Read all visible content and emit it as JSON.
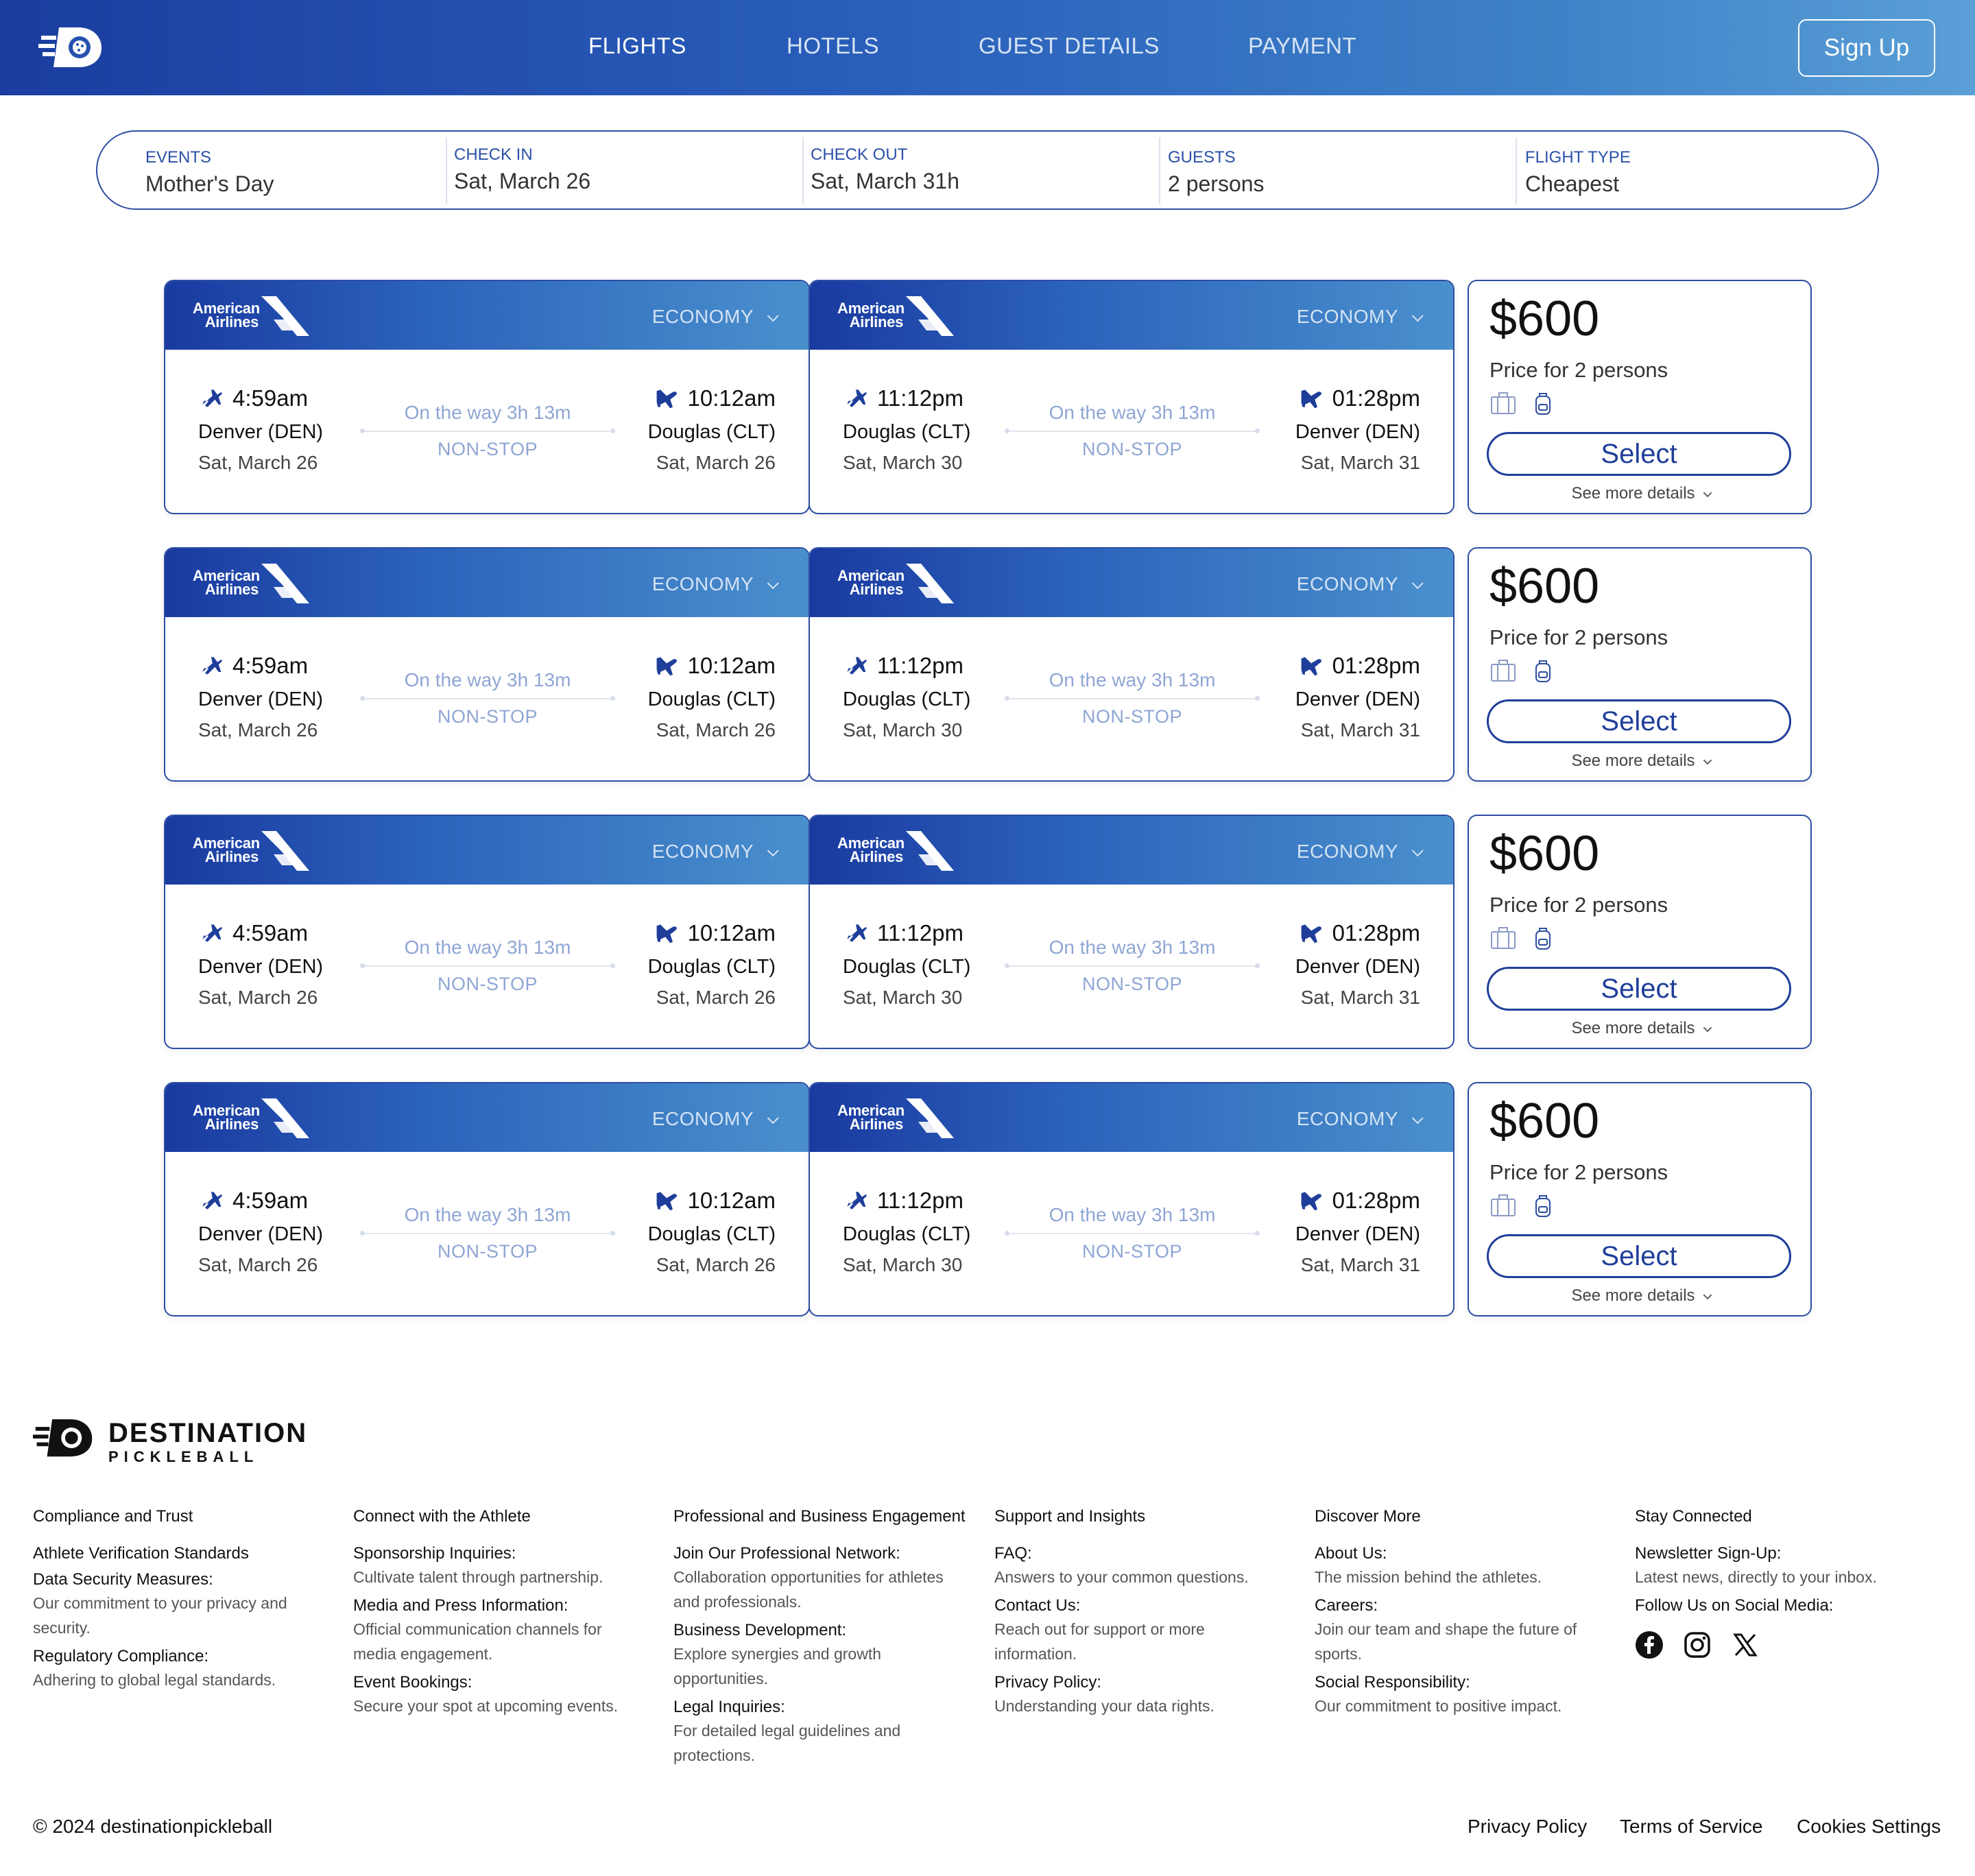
{
  "header": {
    "nav": [
      {
        "label": "FLIGHTS",
        "active": true
      },
      {
        "label": "HOTELS",
        "active": false
      },
      {
        "label": "GUEST DETAILS",
        "active": false
      },
      {
        "label": "PAYMENT",
        "active": false
      }
    ],
    "signup_label": "Sign Up"
  },
  "search": {
    "fields": [
      {
        "label": "EVENTS",
        "value": "Mother's Day"
      },
      {
        "label": "CHECK IN",
        "value": "Sat, March 26"
      },
      {
        "label": "CHECK OUT",
        "value": "Sat, March 31h"
      },
      {
        "label": "GUESTS",
        "value": "2 persons"
      },
      {
        "label": "FLIGHT TYPE",
        "value": "Cheapest"
      }
    ]
  },
  "results": [
    {
      "outbound": {
        "airline_line1": "American",
        "airline_line2": "Airlines",
        "cabin": "ECONOMY",
        "dep_time": "4:59am",
        "dep_city": "Denver (DEN)",
        "dep_date": "Sat, March 26",
        "duration": "On the way 3h 13m",
        "stops": "NON-STOP",
        "arr_time": "10:12am",
        "arr_city": "Douglas (CLT)",
        "arr_date": "Sat, March 26"
      },
      "return": {
        "airline_line1": "American",
        "airline_line2": "Airlines",
        "cabin": "ECONOMY",
        "dep_time": "11:12pm",
        "dep_city": "Douglas (CLT)",
        "dep_date": "Sat, March 30",
        "duration": "On the way 3h 13m",
        "stops": "NON-STOP",
        "arr_time": "01:28pm",
        "arr_city": "Denver (DEN)",
        "arr_date": "Sat, March 31"
      },
      "price": "$600",
      "price_note": "Price for 2 persons",
      "select_label": "Select",
      "details_label": "See more details"
    },
    {
      "outbound": {
        "airline_line1": "American",
        "airline_line2": "Airlines",
        "cabin": "ECONOMY",
        "dep_time": "4:59am",
        "dep_city": "Denver (DEN)",
        "dep_date": "Sat, March 26",
        "duration": "On the way 3h 13m",
        "stops": "NON-STOP",
        "arr_time": "10:12am",
        "arr_city": "Douglas (CLT)",
        "arr_date": "Sat, March 26"
      },
      "return": {
        "airline_line1": "American",
        "airline_line2": "Airlines",
        "cabin": "ECONOMY",
        "dep_time": "11:12pm",
        "dep_city": "Douglas (CLT)",
        "dep_date": "Sat, March 30",
        "duration": "On the way 3h 13m",
        "stops": "NON-STOP",
        "arr_time": "01:28pm",
        "arr_city": "Denver (DEN)",
        "arr_date": "Sat, March 31"
      },
      "price": "$600",
      "price_note": "Price for 2 persons",
      "select_label": "Select",
      "details_label": "See more details"
    },
    {
      "outbound": {
        "airline_line1": "American",
        "airline_line2": "Airlines",
        "cabin": "ECONOMY",
        "dep_time": "4:59am",
        "dep_city": "Denver (DEN)",
        "dep_date": "Sat, March 26",
        "duration": "On the way 3h 13m",
        "stops": "NON-STOP",
        "arr_time": "10:12am",
        "arr_city": "Douglas (CLT)",
        "arr_date": "Sat, March 26"
      },
      "return": {
        "airline_line1": "American",
        "airline_line2": "Airlines",
        "cabin": "ECONOMY",
        "dep_time": "11:12pm",
        "dep_city": "Douglas (CLT)",
        "dep_date": "Sat, March 30",
        "duration": "On the way 3h 13m",
        "stops": "NON-STOP",
        "arr_time": "01:28pm",
        "arr_city": "Denver (DEN)",
        "arr_date": "Sat, March 31"
      },
      "price": "$600",
      "price_note": "Price for 2 persons",
      "select_label": "Select",
      "details_label": "See more details"
    },
    {
      "outbound": {
        "airline_line1": "American",
        "airline_line2": "Airlines",
        "cabin": "ECONOMY",
        "dep_time": "4:59am",
        "dep_city": "Denver (DEN)",
        "dep_date": "Sat, March 26",
        "duration": "On the way 3h 13m",
        "stops": "NON-STOP",
        "arr_time": "10:12am",
        "arr_city": "Douglas (CLT)",
        "arr_date": "Sat, March 26"
      },
      "return": {
        "airline_line1": "American",
        "airline_line2": "Airlines",
        "cabin": "ECONOMY",
        "dep_time": "11:12pm",
        "dep_city": "Douglas (CLT)",
        "dep_date": "Sat, March 30",
        "duration": "On the way 3h 13m",
        "stops": "NON-STOP",
        "arr_time": "01:28pm",
        "arr_city": "Denver (DEN)",
        "arr_date": "Sat, March 31"
      },
      "price": "$600",
      "price_note": "Price for 2 persons",
      "select_label": "Select",
      "details_label": "See more details"
    }
  ],
  "footer": {
    "brand_line1": "DESTINATION",
    "brand_line2": "PICKLEBALL",
    "columns": [
      {
        "title": "Compliance and Trust",
        "items": [
          {
            "head": "Athlete Verification Standards",
            "desc": ""
          },
          {
            "head": "Data Security Measures:",
            "desc": "Our commitment to your privacy and security."
          },
          {
            "head": "Regulatory Compliance:",
            "desc": "Adhering to global legal standards."
          }
        ]
      },
      {
        "title": "Connect with the Athlete",
        "items": [
          {
            "head": "Sponsorship Inquiries:",
            "desc": "Cultivate talent through partnership."
          },
          {
            "head": "Media and Press Information:",
            "desc": "Official communication channels for media engagement."
          },
          {
            "head": "Event Bookings:",
            "desc": "Secure your spot at upcoming events."
          }
        ]
      },
      {
        "title": "Professional and Business Engagement",
        "items": [
          {
            "head": "Join Our Professional Network:",
            "desc": "Collaboration opportunities for athletes and professionals."
          },
          {
            "head": "Business Development:",
            "desc": "Explore synergies and growth opportunities."
          },
          {
            "head": "Legal Inquiries:",
            "desc": "For detailed legal guidelines and protections."
          }
        ]
      },
      {
        "title": "Support and Insights",
        "items": [
          {
            "head": "FAQ:",
            "desc": "Answers to your common questions."
          },
          {
            "head": "Contact Us:",
            "desc": "Reach out for support or more information."
          },
          {
            "head": "Privacy Policy:",
            "desc": "Understanding your data rights."
          }
        ]
      },
      {
        "title": "Discover More",
        "items": [
          {
            "head": "About Us:",
            "desc": "The mission behind the athletes."
          },
          {
            "head": "Careers:",
            "desc": "Join our team and shape the future of sports."
          },
          {
            "head": "Social Responsibility:",
            "desc": "Our commitment to positive impact."
          }
        ]
      },
      {
        "title": "Stay Connected",
        "items": [
          {
            "head": "Newsletter Sign-Up:",
            "desc": "Latest news, directly to your inbox."
          },
          {
            "head": "Follow Us on Social Media:",
            "desc": ""
          }
        ]
      }
    ],
    "social_icons": [
      "facebook-icon",
      "instagram-icon",
      "x-icon"
    ],
    "copyright": "© 2024 destinationpickleball",
    "legal_links": [
      "Privacy Policy",
      "Terms of Service",
      "Cookies Settings"
    ]
  }
}
